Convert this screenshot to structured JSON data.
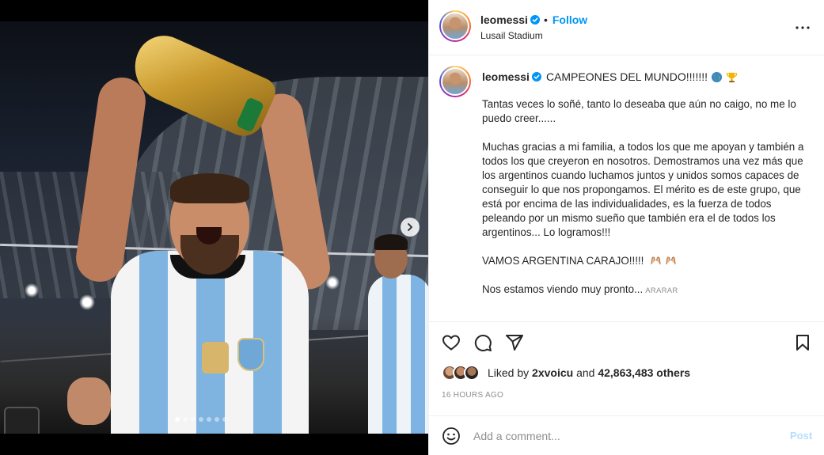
{
  "post": {
    "username": "leomessi",
    "separator": "•",
    "follow_label": "Follow",
    "location": "Lusail Stadium",
    "more_icon": "more-horizontal-icon"
  },
  "caption": {
    "username": "leomessi",
    "title": "CAMPEONES DEL MUNDO!!!!!!!",
    "paragraphs": [
      "Tantas veces lo soñé, tanto lo deseaba que aún no caigo, no me lo puedo creer......",
      "Muchas gracias a mi familia, a todos los que me apoyan y también a todos los que creyeron en nosotros. Demostramos una vez más que los argentinos cuando luchamos juntos y unidos somos capaces de conseguir lo que nos propongamos. El mérito es de este grupo, que está por encima de las individualidades, es la fuerza de todos peleando por un mismo sueño que también era el de todos los argentinos... Lo logramos!!!",
      "VAMOS ARGENTINA CARAJO!!!!!"
    ],
    "last_line": "Nos estamos viendo muy pronto...",
    "more_label": "ARARAR"
  },
  "likes": {
    "prefix": "Liked by",
    "user": "2xvoicu",
    "middle": "and",
    "count": "42,863,483 others"
  },
  "timestamp": "16 HOURS AGO",
  "comment": {
    "placeholder": "Add a comment...",
    "post_label": "Post"
  },
  "carousel": {
    "total_slides": 7,
    "active_index": 0
  },
  "colors": {
    "accent": "#0095f6",
    "post_disabled": "#b2dffc",
    "muted": "#8e8e8e",
    "text": "#262626"
  }
}
